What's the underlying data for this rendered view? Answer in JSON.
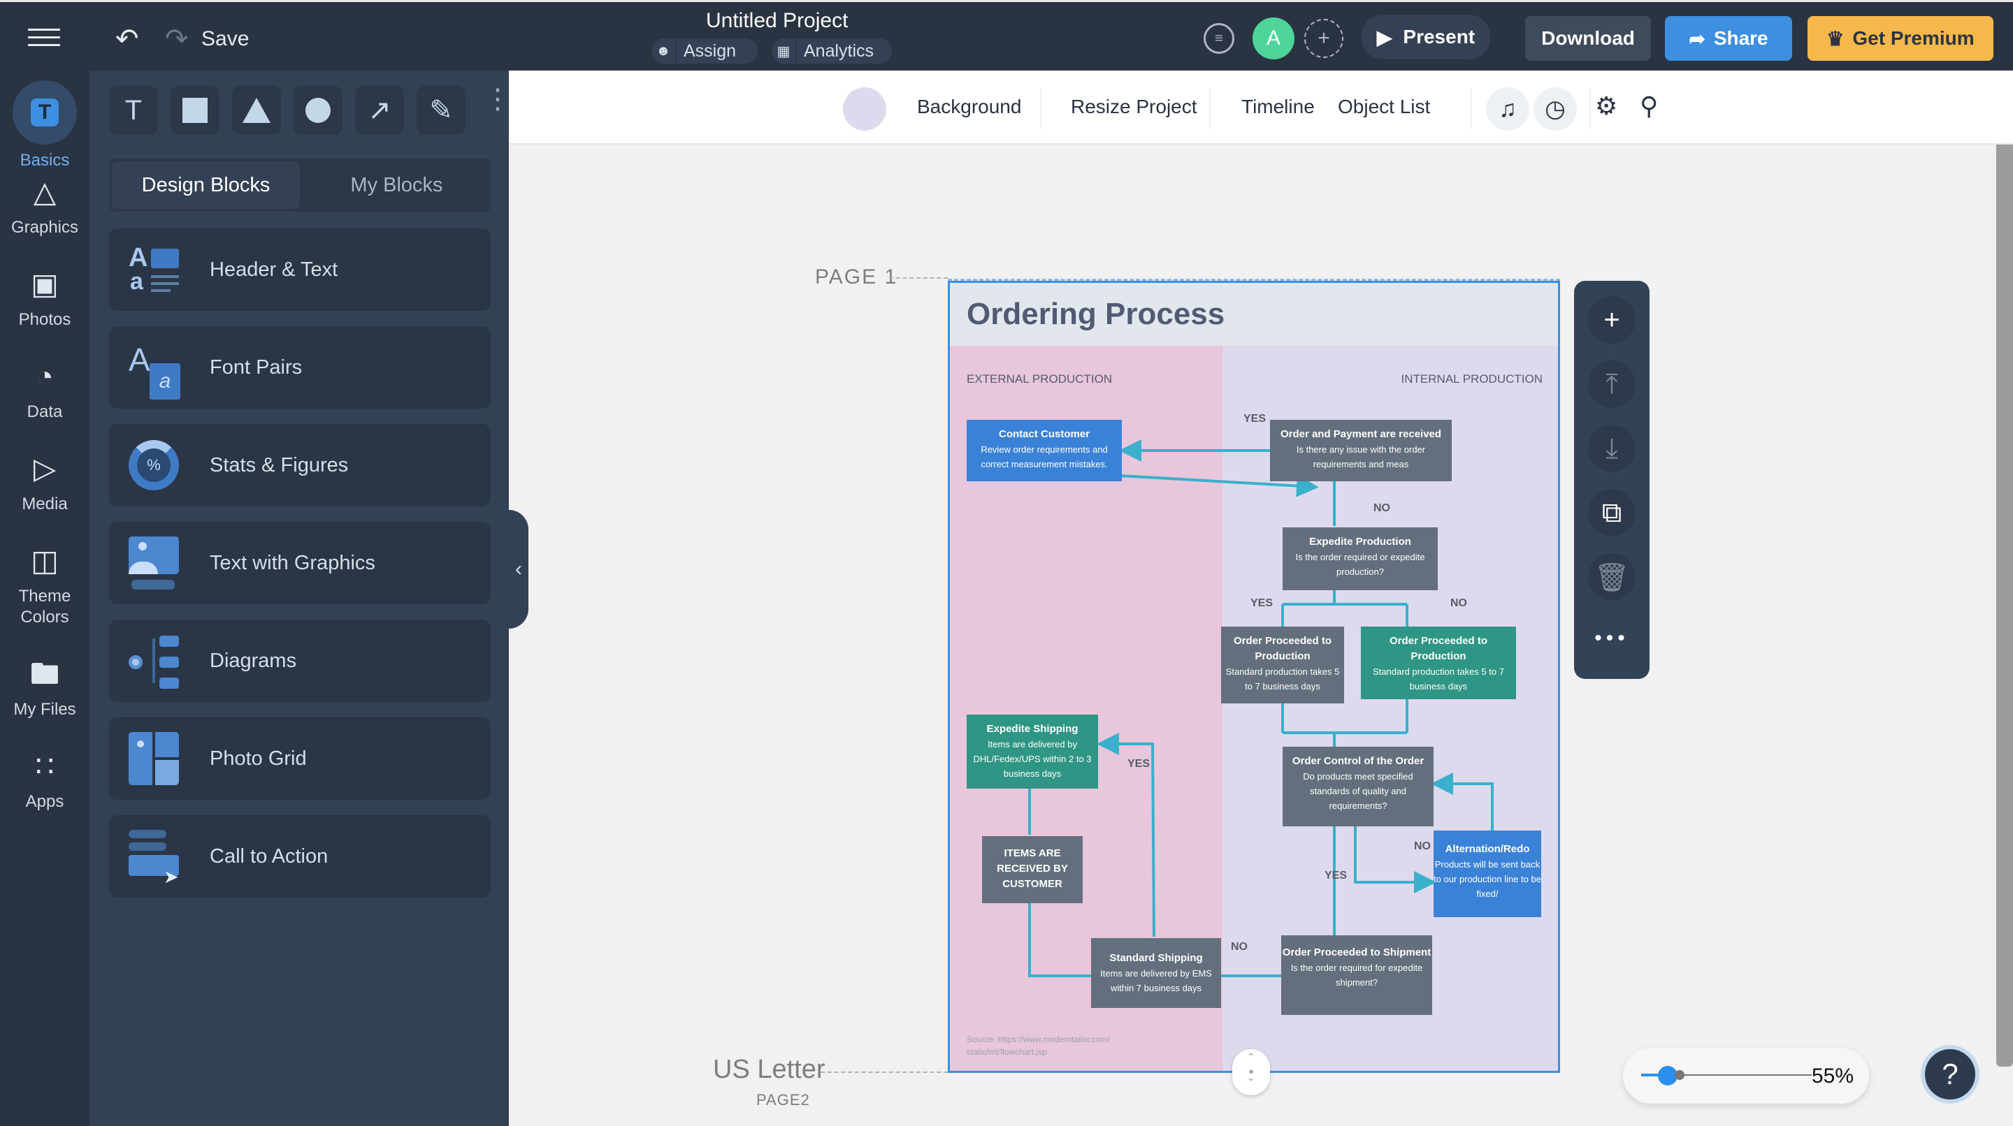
{
  "topbar": {
    "save_label": "Save",
    "project_title": "Untitled Project",
    "assign_label": "Assign",
    "analytics_label": "Analytics",
    "avatar_initial": "A",
    "present_label": "Present",
    "download_label": "Download",
    "share_label": "Share",
    "premium_label": "Get Premium",
    "colors": {
      "share": "#3d8fe0",
      "premium": "#f7b84b",
      "avatar": "#4fd59a"
    }
  },
  "rail": {
    "items": [
      {
        "label": "Basics",
        "icon": "text-t-icon",
        "active": true
      },
      {
        "label": "Graphics",
        "icon": "shapes-icon"
      },
      {
        "label": "Photos",
        "icon": "photo-icon"
      },
      {
        "label": "Data",
        "icon": "pie-chart-icon"
      },
      {
        "label": "Media",
        "icon": "video-icon"
      },
      {
        "label": "Theme Colors",
        "label_line1": "Theme",
        "label_line2": "Colors",
        "icon": "palette-icon"
      },
      {
        "label": "My Files",
        "icon": "folder-icon"
      },
      {
        "label": "Apps",
        "icon": "apps-grid-icon"
      }
    ]
  },
  "panel": {
    "tools": [
      "text-tool",
      "rectangle-tool",
      "triangle-tool",
      "circle-tool",
      "line-tool",
      "pen-tool"
    ],
    "tabs": [
      {
        "label": "Design Blocks",
        "active": true
      },
      {
        "label": "My Blocks"
      }
    ],
    "blocks": [
      {
        "label": "Header & Text"
      },
      {
        "label": "Font Pairs"
      },
      {
        "label": "Stats & Figures"
      },
      {
        "label": "Text with Graphics"
      },
      {
        "label": "Diagrams"
      },
      {
        "label": "Photo Grid"
      },
      {
        "label": "Call to Action"
      }
    ]
  },
  "subbar": {
    "background_label": "Background",
    "background_color": "#dcdbee",
    "resize_label": "Resize Project",
    "timeline_label": "Timeline",
    "object_list_label": "Object List"
  },
  "canvas": {
    "page_label": "PAGE 1",
    "size_label": "US Letter",
    "next_page_label": "PAGE2",
    "zoom_percent": "55%",
    "zoom_value": 55
  },
  "document": {
    "title": "Ordering Process",
    "lane_external": "EXTERNAL PRODUCTION",
    "lane_internal": "INTERNAL PRODUCTION",
    "nodes": {
      "contact": {
        "title": "Contact Customer",
        "body": "Review order requirements and correct measurement mistakes."
      },
      "order_payment": {
        "title": "Order and Payment are received",
        "body": "Is there any issue with the order requirements and meas"
      },
      "expedite_prod": {
        "title": "Expedite Production",
        "body": "Is the order required or expedite production?"
      },
      "proceed_prod_yes": {
        "title": "Order Proceeded to Production",
        "body": "Standard production takes 5 to 7 business days"
      },
      "proceed_prod_no": {
        "title": "Order Proceeded to Production",
        "body": "Standard production takes 5 to 7 business days"
      },
      "expedite_ship": {
        "title": "Expedite Shipping",
        "body": "Items are delivered by DHL/Fedex/UPS within 2 to 3 business days"
      },
      "received": {
        "title": "ITEMS ARE RECEIVED BY CUSTOMER"
      },
      "order_control": {
        "title": "Order Control of the Order",
        "body": "Do products meet specified standards of quality and requirements?"
      },
      "redo": {
        "title": "Alternation/Redo",
        "body": "Products will be sent back to our production line to be fixed/"
      },
      "standard_ship": {
        "title": "Standard Shipping",
        "body": "Items are delivered by EMS within 7 business days"
      },
      "proceed_ship": {
        "title": "Order Proceeded to Shipment",
        "body": "Is the order required for expedite shipment?"
      }
    },
    "labels": {
      "yes": "YES",
      "no": "NO"
    },
    "source": "Source: https://www.moderntailor.com/ static/mt/flowchart.jsp"
  }
}
